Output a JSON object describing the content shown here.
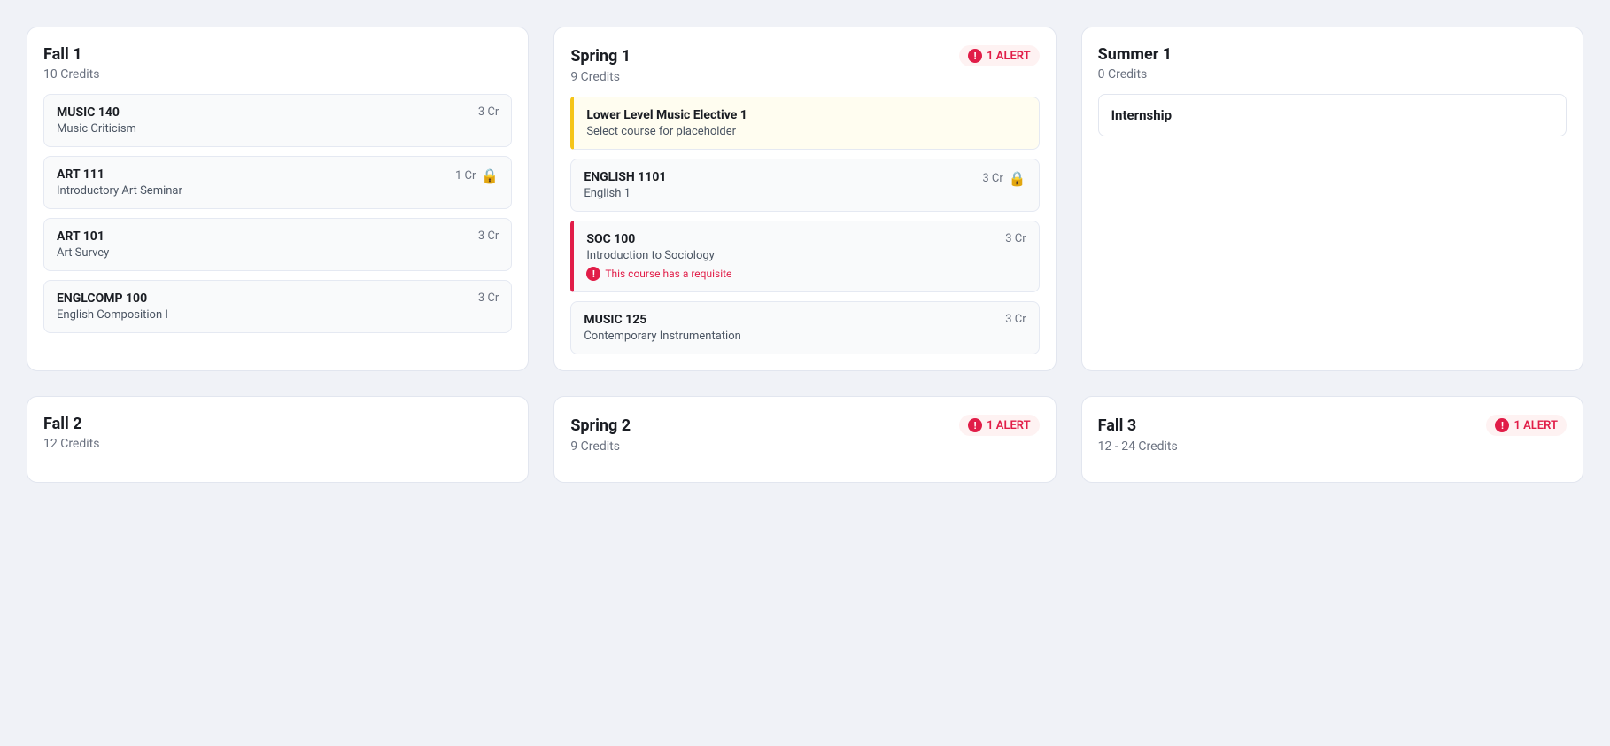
{
  "semesters": [
    {
      "id": "fall1",
      "title": "Fall 1",
      "credits": "10 Credits",
      "alert": null,
      "courses": [
        {
          "code": "MUSIC 140",
          "name": "Music Criticism",
          "credits": "3 Cr",
          "type": "normal",
          "lock": false,
          "alert_msg": null
        },
        {
          "code": "ART 111",
          "name": "Introductory Art Seminar",
          "credits": "1 Cr",
          "type": "normal",
          "lock": true,
          "alert_msg": null
        },
        {
          "code": "ART 101",
          "name": "Art Survey",
          "credits": "3 Cr",
          "type": "normal",
          "lock": false,
          "alert_msg": null
        },
        {
          "code": "ENGLCOMP 100",
          "name": "English Composition I",
          "credits": "3 Cr",
          "type": "normal",
          "lock": false,
          "alert_msg": null
        }
      ]
    },
    {
      "id": "spring1",
      "title": "Spring 1",
      "credits": "9 Credits",
      "alert": {
        "count": "1 ALERT"
      },
      "courses": [
        {
          "code": "Lower Level Music Elective 1",
          "name": "Select course for placeholder",
          "credits": "",
          "type": "placeholder",
          "lock": false,
          "alert_msg": null
        },
        {
          "code": "ENGLISH 1101",
          "name": "English 1",
          "credits": "3 Cr",
          "type": "normal",
          "lock": true,
          "alert_msg": null
        },
        {
          "code": "SOC 100",
          "name": "Introduction to Sociology",
          "credits": "3 Cr",
          "type": "alert",
          "lock": false,
          "alert_msg": "This course has a requisite"
        },
        {
          "code": "MUSIC 125",
          "name": "Contemporary Instrumentation",
          "credits": "3 Cr",
          "type": "normal",
          "lock": false,
          "alert_msg": null
        }
      ]
    },
    {
      "id": "summer1",
      "title": "Summer 1",
      "credits": "0 Credits",
      "alert": null,
      "courses": [
        {
          "code": "Internship",
          "name": "",
          "credits": "",
          "type": "internship",
          "lock": false,
          "alert_msg": null
        }
      ]
    },
    {
      "id": "fall2",
      "title": "Fall 2",
      "credits": "12 Credits",
      "alert": null,
      "courses": []
    },
    {
      "id": "spring2",
      "title": "Spring 2",
      "credits": "9 Credits",
      "alert": {
        "count": "1 ALERT"
      },
      "courses": []
    },
    {
      "id": "fall3",
      "title": "Fall 3",
      "credits": "12 - 24 Credits",
      "alert": {
        "count": "1 ALERT"
      },
      "courses": []
    }
  ]
}
